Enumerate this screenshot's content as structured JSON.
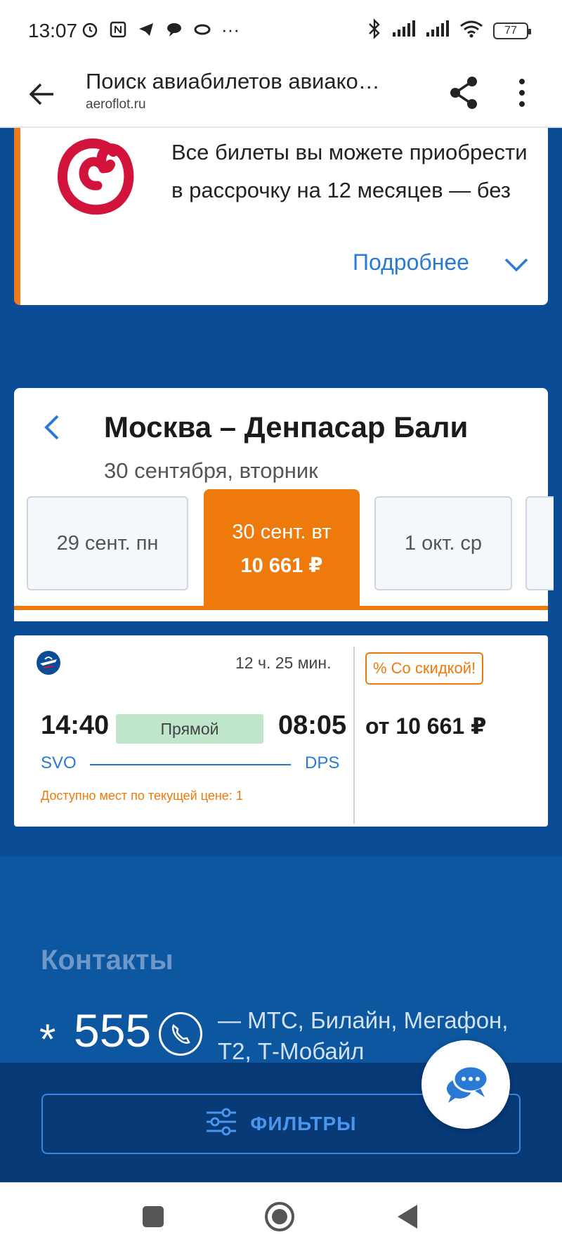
{
  "status_bar": {
    "time": "13:07",
    "battery": "77",
    "left_icons": [
      "alarm-icon",
      "nfc-icon",
      "telegram-icon",
      "chat-bubble-icon",
      "link-icon",
      "more-notifications-icon"
    ],
    "right_icons": [
      "bluetooth-icon",
      "signal-icon",
      "signal-icon",
      "wifi-icon",
      "battery-icon"
    ],
    "more_indicator": "···"
  },
  "browser": {
    "title": "Поиск авиабилетов авиако…",
    "url": "aeroflot.ru"
  },
  "promo": {
    "text": "Все билеты вы можете приобрести в рассрочку на 12 месяцев — без",
    "more_label": "Подробнее"
  },
  "route": {
    "title": "Москва – Денпасар Бали",
    "date": "30 сентября, вторник"
  },
  "date_tabs": [
    {
      "label": "29 сент. пн",
      "price": "",
      "active": false
    },
    {
      "label": "30 сент. вт",
      "price": "10 661 ₽",
      "active": true
    },
    {
      "label": "1 окт. ср",
      "price": "",
      "active": false
    }
  ],
  "flight": {
    "duration": "12 ч. 25 мин.",
    "departure_time": "14:40",
    "arrival_time": "08:05",
    "type": "Прямой",
    "departure_code": "SVO",
    "arrival_code": "DPS",
    "seats_note": "Доступно мест по текущей цене: 1",
    "discount_badge": "% Со скидкой!",
    "price": "от 10 661 ₽"
  },
  "contacts": {
    "title": "Контакты",
    "star": "*",
    "number": "555",
    "carriers": "— МТС, Билайн, Мегафон, Т2, Т-Мобайл"
  },
  "filters": {
    "label": "ФИЛЬТРЫ"
  },
  "colors": {
    "accent_orange": "#ef7a0c",
    "brand_blue": "#0b4c97",
    "link_blue": "#2a7ad3",
    "direct_green": "#bfe5cb"
  }
}
